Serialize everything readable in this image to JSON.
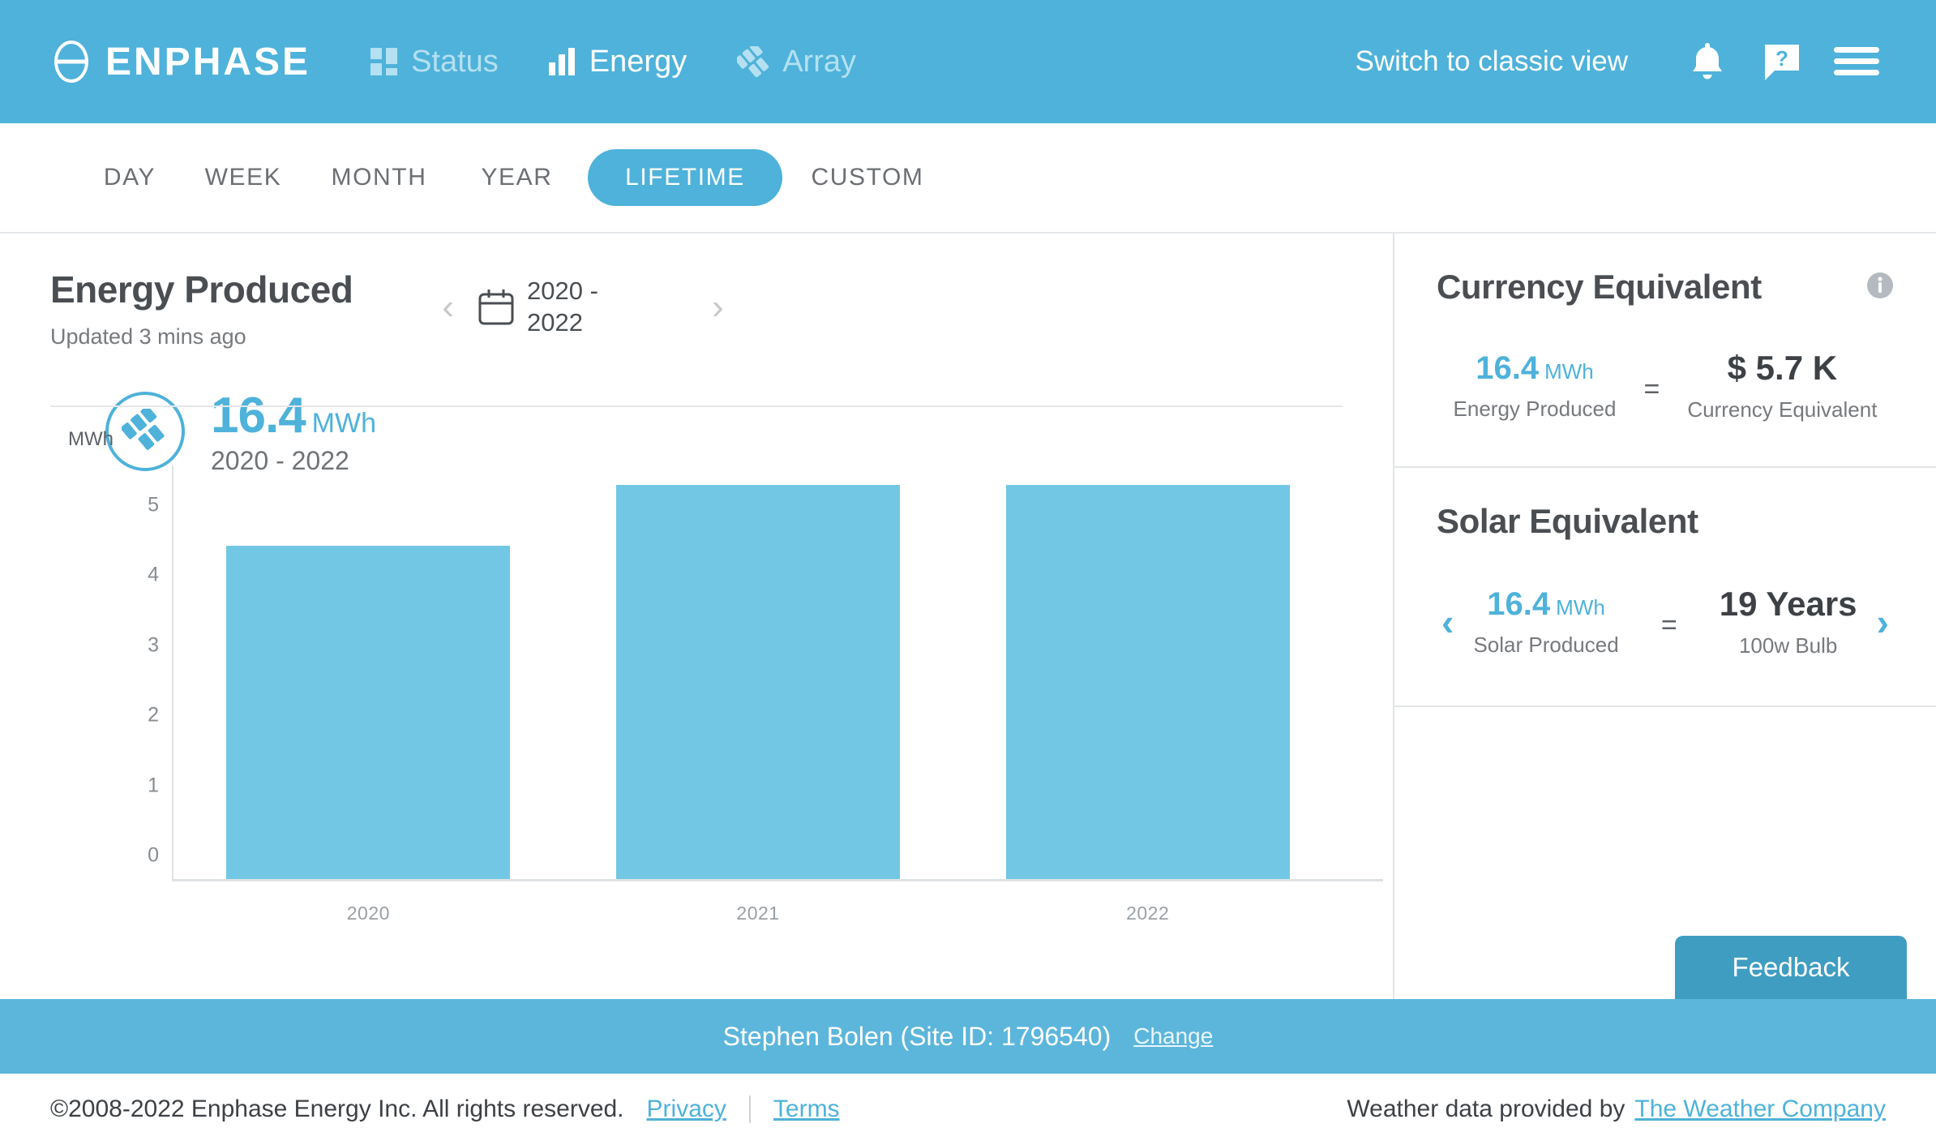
{
  "header": {
    "brand": "ENPHASE",
    "nav": [
      {
        "label": "Status",
        "icon": "status-grid-icon",
        "active": false
      },
      {
        "label": "Energy",
        "icon": "bar-chart-icon",
        "active": true
      },
      {
        "label": "Array",
        "icon": "array-panels-icon",
        "active": false
      }
    ],
    "classic_view": "Switch to classic view",
    "icons": [
      "notification-bell-icon",
      "help-icon",
      "menu-icon"
    ],
    "accent": "#4eb2da"
  },
  "tabs": {
    "items": [
      "DAY",
      "WEEK",
      "MONTH",
      "YEAR",
      "LIFETIME",
      "CUSTOM"
    ],
    "active": "LIFETIME"
  },
  "chart_panel": {
    "title": "Energy Produced",
    "updated": "Updated 3 mins ago",
    "date_range": "2020 - 2022",
    "prev_label": "‹",
    "next_label": "›",
    "summary": {
      "value": "16.4",
      "unit": "MWh",
      "range": "2020 - 2022"
    }
  },
  "chart_data": {
    "type": "bar",
    "title": "Energy Produced",
    "categories": [
      "2020",
      "2021",
      "2022"
    ],
    "values": [
      4.75,
      5.62,
      5.62
    ],
    "xlabel": "",
    "ylabel": "MWh",
    "yticks": [
      0,
      1,
      2,
      3,
      4,
      5
    ],
    "ylim": [
      0,
      5.9
    ],
    "grid": false,
    "legend": false,
    "bar_color": "#72c7e4",
    "total": "16.4 MWh"
  },
  "sidebar": {
    "currency": {
      "title": "Currency Equivalent",
      "info_icon": "info-icon",
      "left_value": "16.4",
      "left_unit": "MWh",
      "left_caption": "Energy Produced",
      "equals": "=",
      "right_value": "$ 5.7 K",
      "right_caption": "Currency Equivalent"
    },
    "solar": {
      "title": "Solar Equivalent",
      "prev": "‹",
      "next": "›",
      "left_value": "16.4",
      "left_unit": "MWh",
      "left_caption": "Solar Produced",
      "equals": "=",
      "right_value": "19 Years",
      "right_caption": "100w Bulb"
    },
    "feedback": "Feedback"
  },
  "site_bar": {
    "text": "Stephen Bolen (Site ID: 1796540)",
    "change": "Change"
  },
  "footer": {
    "copyright": "©2008-2022 Enphase Energy Inc. All rights reserved.",
    "privacy": "Privacy",
    "terms": "Terms",
    "weather_text": "Weather data provided by",
    "weather_link": "The Weather Company"
  }
}
